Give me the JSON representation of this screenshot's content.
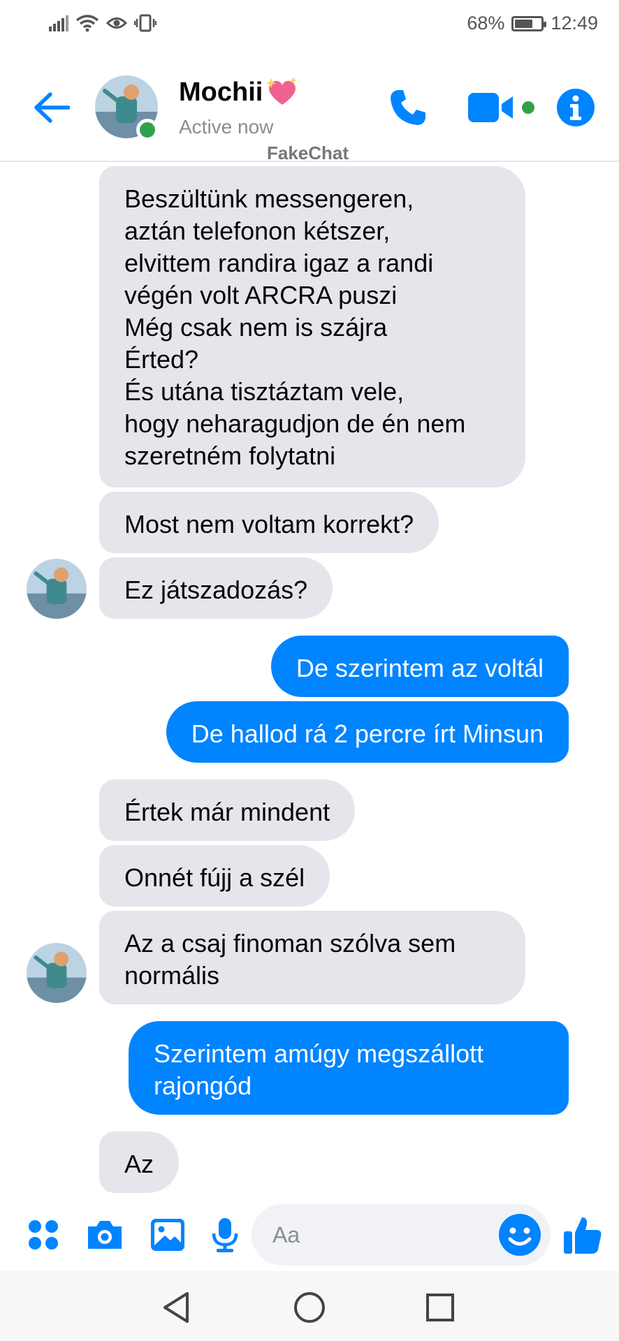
{
  "status_bar": {
    "battery_percent": "68%",
    "battery_level": 0.68,
    "time": "12:49"
  },
  "header": {
    "contact_name": "Mochii",
    "contact_status": "Active now",
    "watermark": "FakeChat"
  },
  "messages": [
    {
      "side": "in",
      "text": "Beszültünk messengeren,\naztán telefonon kétszer,\nelvittem randira igaz a randi\nvégén volt ARCRA puszi\nMég csak nem is szájra\nÉrted?\nÉs utána tisztáztam vele,\nhogy neharagudjon de én nem\nszeretném folytatni"
    },
    {
      "side": "in",
      "text": "Most nem voltam korrekt?"
    },
    {
      "side": "in",
      "text": "Ez játszadozás?"
    },
    {
      "side": "out",
      "text": "De szerintem az voltál"
    },
    {
      "side": "out",
      "text": "De hallod rá 2 percre írt Minsun"
    },
    {
      "side": "in",
      "text": "Értek már mindent"
    },
    {
      "side": "in",
      "text": "Onnét fújj a szél"
    },
    {
      "side": "in",
      "text": "Az a csaj finoman szólva sem\nnormális"
    },
    {
      "side": "out",
      "text": "Szerintem amúgy megszállott\nrajongód"
    },
    {
      "side": "in",
      "text": "Az"
    }
  ],
  "composer": {
    "placeholder": "Aa"
  },
  "colors": {
    "accent": "#0084ff",
    "incoming_bubble": "#e4e6eb",
    "online": "#31a24c"
  },
  "icons": {
    "header": [
      "back-arrow-icon",
      "phone-icon",
      "video-camera-icon",
      "info-icon"
    ],
    "composer": [
      "apps-grid-icon",
      "camera-icon",
      "gallery-icon",
      "microphone-icon",
      "emoji-icon",
      "thumbs-up-icon"
    ],
    "nav": [
      "nav-back-icon",
      "nav-home-icon",
      "nav-recents-icon"
    ]
  }
}
